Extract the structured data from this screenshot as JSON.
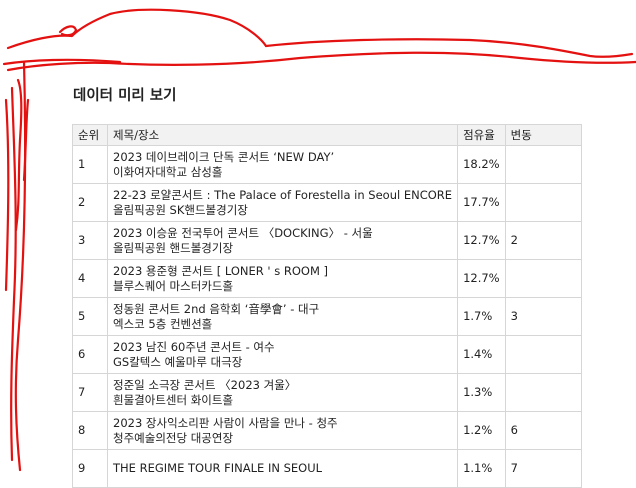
{
  "heading": "데이터 미리 보기",
  "columns": [
    "순위",
    "제목/장소",
    "점유율",
    "변동"
  ],
  "rows": [
    {
      "rank": "1",
      "title": "2023 데이브레이크 단독 콘서트 ‘NEW DAY’",
      "venue": "이화여자대학교 삼성홀",
      "share": "18.2%",
      "change": ""
    },
    {
      "rank": "2",
      "title": "22-23 로얄콘서트 : The Palace of Forestella in Seoul ENCORE",
      "venue": "올림픽공원 SK핸드볼경기장",
      "share": "17.7%",
      "change": ""
    },
    {
      "rank": "3",
      "title": "2023 이승윤 전국투어 콘서트 〈DOCKING〉 - 서울",
      "venue": "올림픽공원 핸드볼경기장",
      "share": "12.7%",
      "change": "2"
    },
    {
      "rank": "4",
      "title": "2023 용준형 콘서트 [ LONER ' s ROOM ]",
      "venue": "블루스퀘어 마스터카드홀",
      "share": "12.7%",
      "change": ""
    },
    {
      "rank": "5",
      "title": "정동원 콘서트 2nd 음학회 ‘音學會’ - 대구",
      "venue": "엑스코 5층 컨벤션홀",
      "share": "1.7%",
      "change": "3"
    },
    {
      "rank": "6",
      "title": "2023 남진 60주년 콘서트 - 여수",
      "venue": "GS칼텍스 예울마루 대극장",
      "share": "1.4%",
      "change": ""
    },
    {
      "rank": "7",
      "title": "정준일 소극장 콘서트 〈2023 겨울〉",
      "venue": "흰물결아트센터 화이트홀",
      "share": "1.3%",
      "change": ""
    },
    {
      "rank": "8",
      "title": "2023 장사익소리판 사람이 사람을 만나 - 청주",
      "venue": "청주예술의전당 대공연장",
      "share": "1.2%",
      "change": "6"
    },
    {
      "rank": "9",
      "title": "THE REGIME TOUR FINALE IN SEOUL",
      "venue": "",
      "share": "1.1%",
      "change": "7"
    }
  ]
}
